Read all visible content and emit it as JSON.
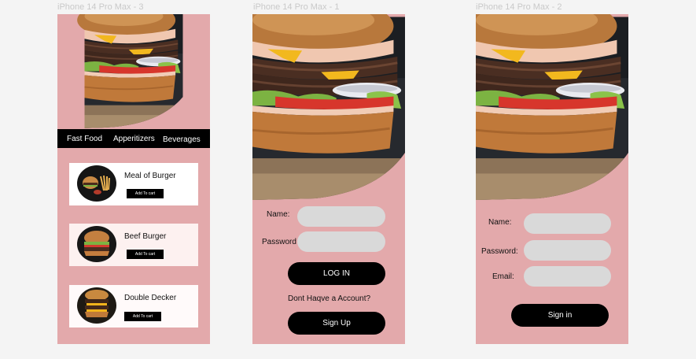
{
  "frames": [
    {
      "label": "iPhone 14 Pro Max - 3",
      "categories": [
        "Fast Food",
        "Apperitizers",
        "Beverages"
      ],
      "items": [
        {
          "title": "Meal of Burger",
          "button": "Add To cart",
          "bg": "#ffffff"
        },
        {
          "title": "Beef Burger",
          "button": "Add To cart",
          "bg": "#fdf1f0"
        },
        {
          "title": "Double Decker",
          "button": "Add To cart",
          "bg": "#fffafa"
        }
      ]
    },
    {
      "label": "iPhone 14 Pro Max - 1",
      "name_label": "Name:",
      "password_label": "Password",
      "login_button": "LOG IN",
      "account_prompt": "Dont Haqve a Account?",
      "signup_button": "Sign Up"
    },
    {
      "label": "iPhone 14 Pro Max - 2",
      "name_label": "Name:",
      "password_label": "Password:",
      "email_label": "Email:",
      "signin_button": "Sign in"
    }
  ],
  "colors": {
    "frame_bg": "#e3a9ab",
    "field_bg": "#d9d9d9",
    "dark": "#000000",
    "canvas_bg": "#f4f4f4"
  },
  "images": [
    "burger-photo",
    "burger-meal-photo",
    "beef-burger-photo",
    "double-decker-photo"
  ]
}
